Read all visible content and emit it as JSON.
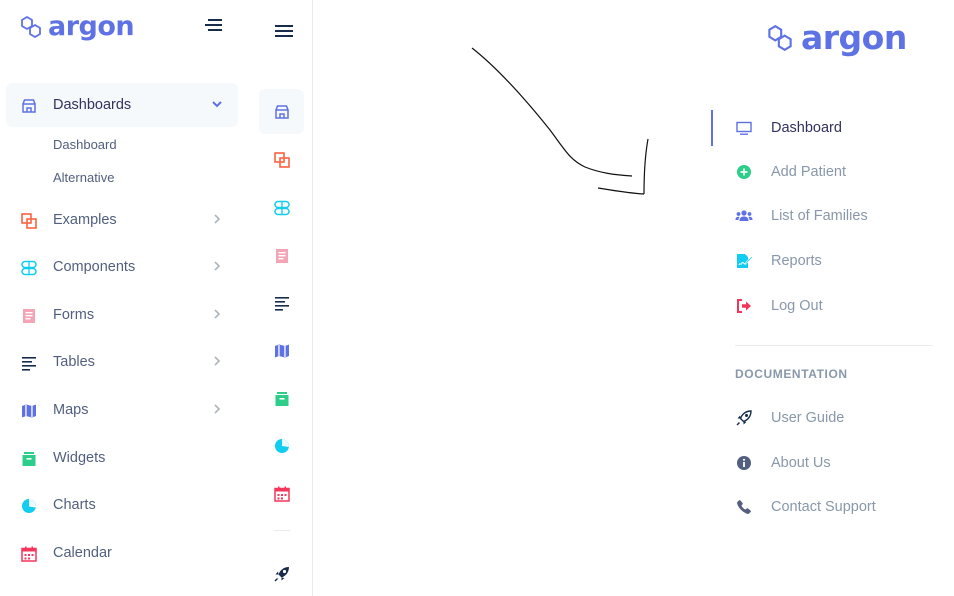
{
  "brand": {
    "name": "argon"
  },
  "left_sidebar": {
    "items": [
      {
        "label": "Dashboards"
      },
      {
        "label": "Examples"
      },
      {
        "label": "Components"
      },
      {
        "label": "Forms"
      },
      {
        "label": "Tables"
      },
      {
        "label": "Maps"
      },
      {
        "label": "Widgets"
      },
      {
        "label": "Charts"
      },
      {
        "label": "Calendar"
      }
    ],
    "submenu": [
      {
        "label": "Dashboard"
      },
      {
        "label": "Alternative"
      }
    ]
  },
  "right_nav": {
    "items": [
      {
        "label": "Dashboard"
      },
      {
        "label": "Add Patient"
      },
      {
        "label": "List of Families"
      },
      {
        "label": "Reports"
      },
      {
        "label": "Log Out"
      }
    ],
    "documentation_heading": "DOCUMENTATION",
    "documentation": [
      {
        "label": "User Guide"
      },
      {
        "label": "About Us"
      },
      {
        "label": "Contact Support"
      }
    ]
  },
  "colors": {
    "primary": "#5e72e4",
    "orange": "#fb6340",
    "info": "#11cdef",
    "pink": "#f3a4b5",
    "default": "#172b4d",
    "green": "#2dce89",
    "red": "#f5365c",
    "muted": "#8898aa"
  },
  "icons": {
    "brand": "hexagons-icon",
    "toggler": "sidenav-toggler-icon",
    "hamburger": "hamburger-icon",
    "dashboards": "shop-icon",
    "examples": "squares-icon",
    "components": "ui-pills-icon",
    "forms": "single-copy-icon",
    "tables": "align-left-icon",
    "maps": "map-big-icon",
    "widgets": "archive-icon",
    "charts": "pie-chart-icon",
    "calendar": "calendar-icon",
    "rocket": "rocket-icon",
    "right_dashboard": "tv-icon",
    "add_patient": "plus-circle-icon",
    "families": "users-icon",
    "reports": "file-signature-icon",
    "logout": "sign-out-icon",
    "user_guide": "spaceship-icon",
    "about": "info-icon",
    "support": "phone-icon"
  }
}
